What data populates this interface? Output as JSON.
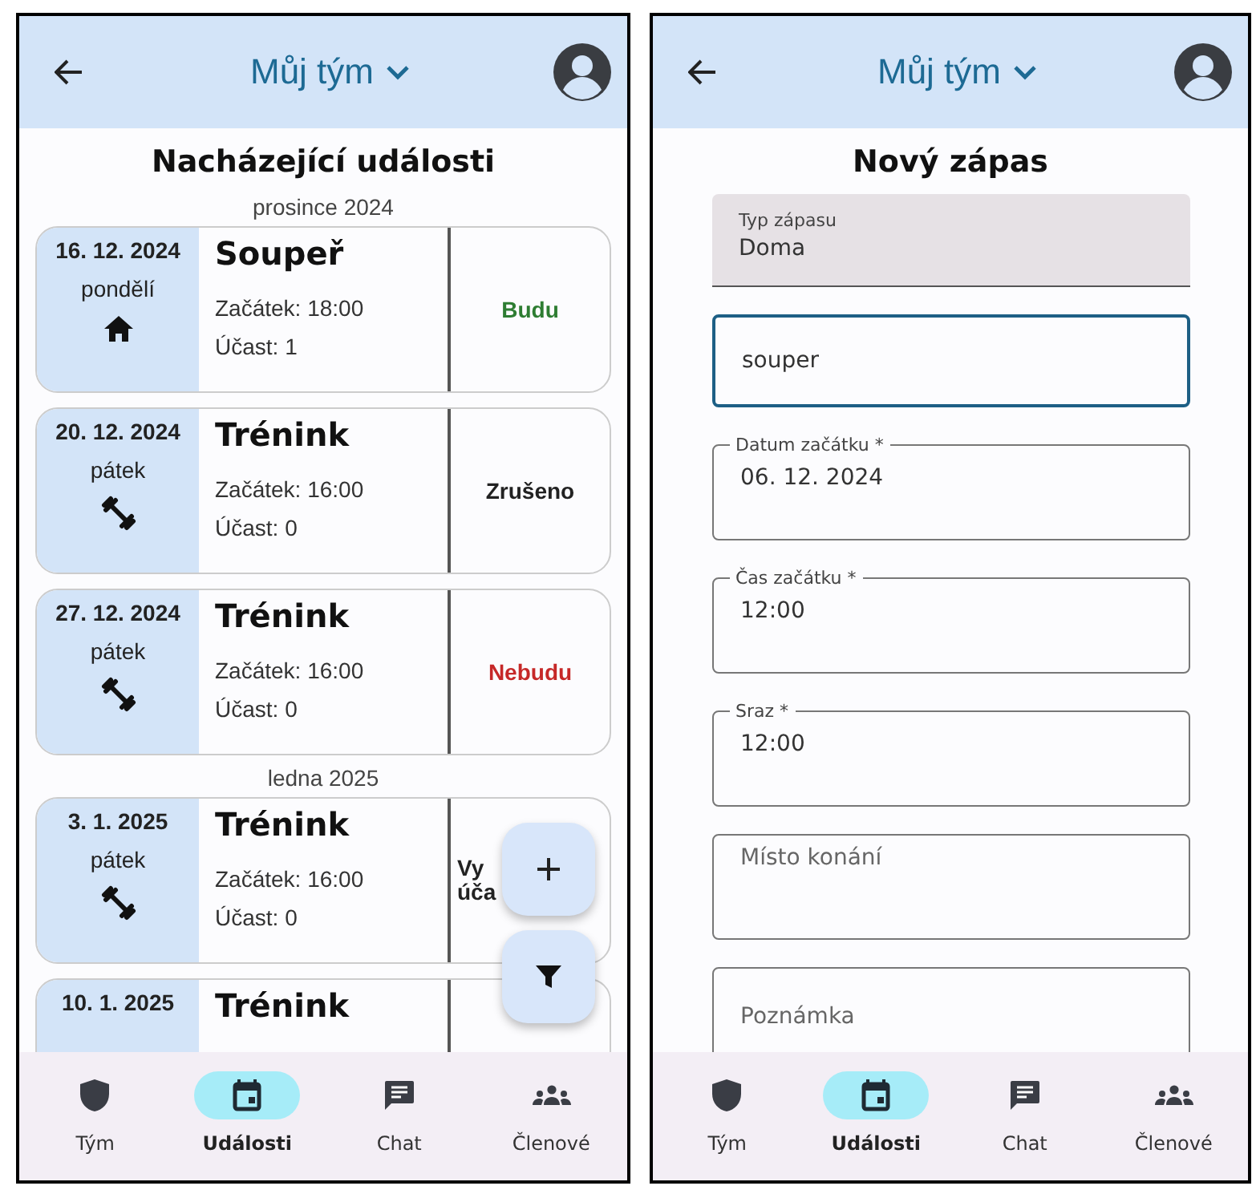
{
  "events_screen": {
    "header": {
      "title": "Můj tým"
    },
    "heading": "Nacházející události",
    "groups": [
      {
        "month": "prosince 2024",
        "events": [
          {
            "date": "16. 12. 2024",
            "weekday": "pondělí",
            "kind": "home",
            "title": "Soupeř",
            "start": "Začátek: 18:00",
            "attendance": "Účast: 1",
            "status": {
              "text": "Budu",
              "kind": "yes"
            }
          },
          {
            "date": "20. 12. 2024",
            "weekday": "pátek",
            "kind": "training",
            "title": "Trénink",
            "start": "Začátek: 16:00",
            "attendance": "Účast: 0",
            "status": {
              "text": "Zrušeno",
              "kind": "cancelled"
            }
          },
          {
            "date": "27. 12. 2024",
            "weekday": "pátek",
            "kind": "training",
            "title": "Trénink",
            "start": "Začátek: 16:00",
            "attendance": "Účast: 0",
            "status": {
              "text": "Nebudu",
              "kind": "no"
            }
          }
        ]
      },
      {
        "month": "ledna 2025",
        "events": [
          {
            "date": "3. 1. 2025",
            "weekday": "pátek",
            "kind": "training",
            "title": "Trénink",
            "start": "Začátek: 16:00",
            "attendance": "Účast: 0",
            "status": {
              "text": "Vy\núča",
              "kind": "pending"
            }
          },
          {
            "date": "10. 1. 2025",
            "title": "Trénink"
          }
        ]
      }
    ],
    "nav": [
      {
        "label": "Tým",
        "kind": "shield",
        "selected": false
      },
      {
        "label": "Události",
        "kind": "calendar",
        "selected": true
      },
      {
        "label": "Chat",
        "kind": "chat",
        "selected": false
      },
      {
        "label": "Členové",
        "kind": "group",
        "selected": false
      }
    ]
  },
  "form_screen": {
    "header": {
      "title": "Můj tým"
    },
    "heading": "Nový zápas",
    "fields": [
      {
        "kind": "filled",
        "label": "Typ zápasu",
        "value": "Doma"
      },
      {
        "kind": "focused",
        "value": "souper"
      },
      {
        "kind": "outlined",
        "label": "Datum začátku *",
        "value": "06. 12. 2024"
      },
      {
        "kind": "outlined",
        "label": "Čas začátku *",
        "value": "12:00"
      },
      {
        "kind": "outlined",
        "label": "Sraz *",
        "value": "12:00"
      },
      {
        "kind": "outlined",
        "placeholder": "Místo konání"
      },
      {
        "kind": "multiline",
        "placeholder": "Poznámka"
      }
    ],
    "nav": [
      {
        "label": "Tým",
        "kind": "shield",
        "selected": false
      },
      {
        "label": "Události",
        "kind": "calendar",
        "selected": true
      },
      {
        "label": "Chat",
        "kind": "chat",
        "selected": false
      },
      {
        "label": "Členové",
        "kind": "group",
        "selected": false
      }
    ]
  }
}
